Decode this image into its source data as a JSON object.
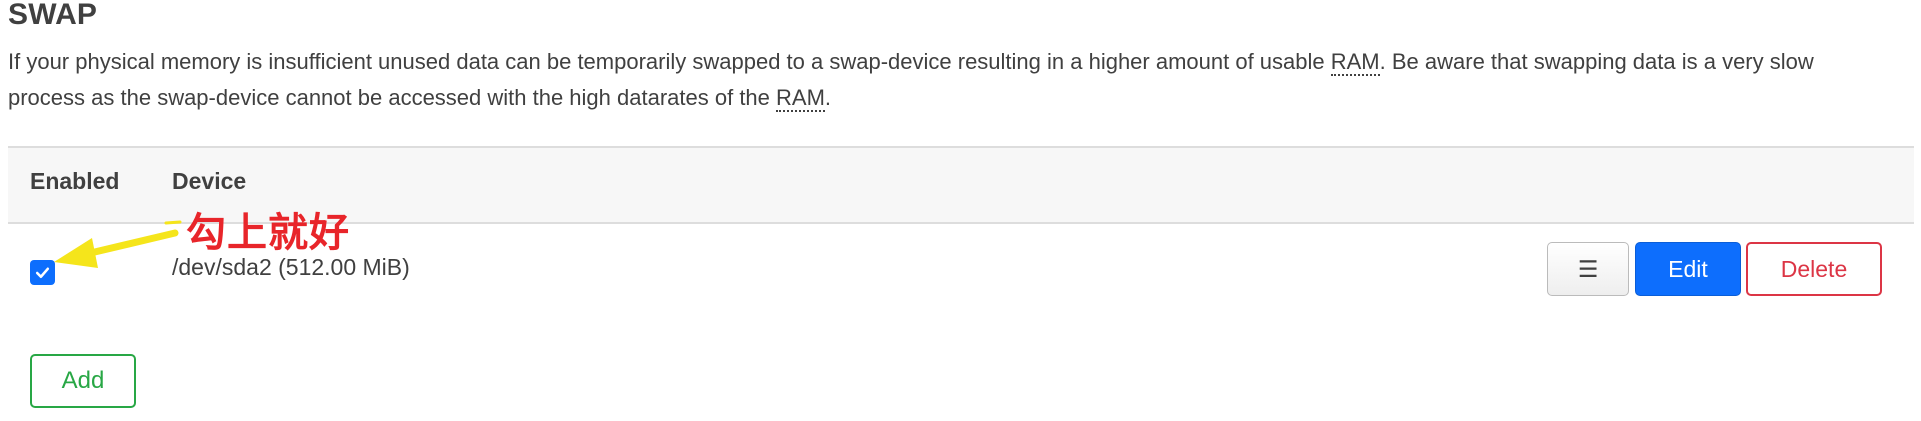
{
  "section": {
    "title": "SWAP",
    "description_part1": "If your physical memory is insufficient unused data can be temporarily swapped to a swap-device resulting in a higher amount of usable ",
    "ram_abbr": "RAM",
    "description_part2": ". Be aware that swapping data is a very slow process as the swap-device cannot be accessed with the high datarates of the ",
    "ram_abbr_2": "RAM",
    "description_part3": "."
  },
  "table": {
    "headers": {
      "enabled": "Enabled",
      "device": "Device"
    },
    "rows": [
      {
        "enabled": true,
        "device": "/dev/sda2 (512.00 MiB)"
      }
    ]
  },
  "buttons": {
    "menu_label": "☰",
    "edit_label": "Edit",
    "delete_label": "Delete",
    "add_label": "Add"
  },
  "annotation": {
    "text": "勾上就好"
  },
  "colors": {
    "primary": "#0d6efd",
    "danger": "#dc3545",
    "success": "#28a745",
    "annotation_text": "#e8252a",
    "annotation_arrow": "#f5e51b"
  }
}
